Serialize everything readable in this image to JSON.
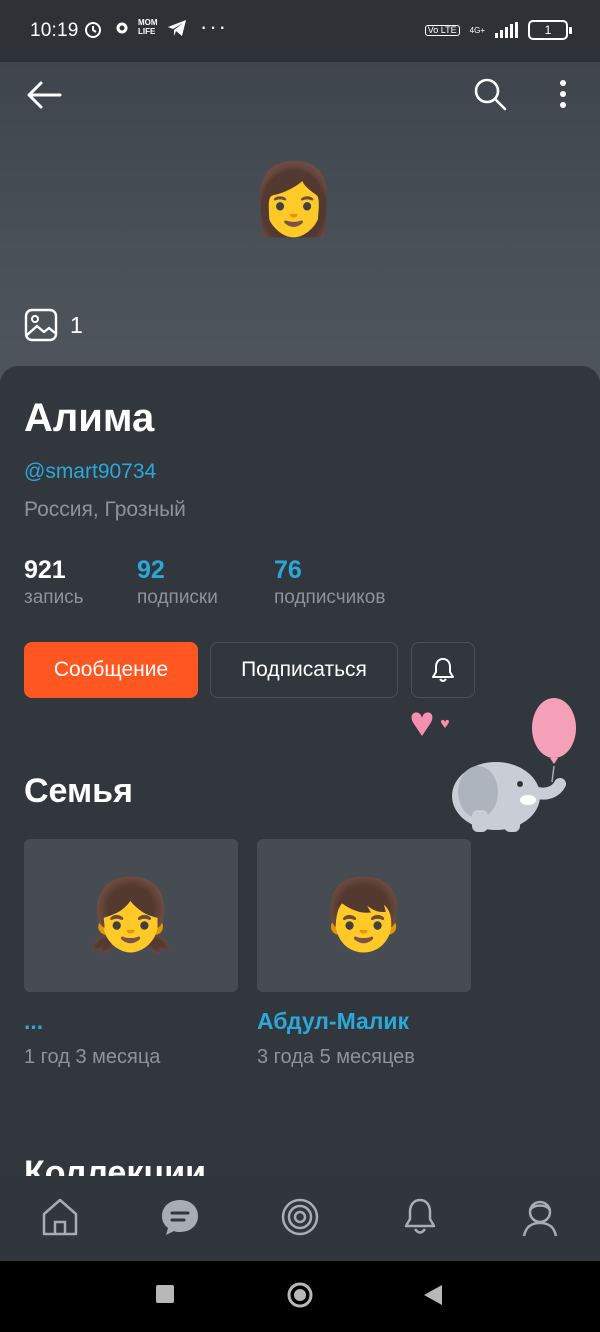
{
  "status_bar": {
    "time": "10:19",
    "more": "···",
    "volte": "Vo LTE",
    "network": "4G+",
    "battery": "1"
  },
  "header": {
    "photo_count": "1",
    "avatar_emoji": "👩"
  },
  "profile": {
    "name": "Алима",
    "handle": "@smart90734",
    "location": "Россия, Грозный",
    "stats": [
      {
        "value": "921",
        "label": "запись"
      },
      {
        "value": "92",
        "label": "подписки"
      },
      {
        "value": "76",
        "label": "подписчиков"
      }
    ],
    "message_button": "Сообщение",
    "subscribe_button": "Подписаться"
  },
  "family": {
    "title": "Семья",
    "members": [
      {
        "emoji": "👧",
        "name": "...",
        "age": "1 год 3 месяца"
      },
      {
        "emoji": "👦",
        "name": "Абдул-Малик",
        "age": "3 года 5 месяцев"
      }
    ]
  },
  "collections": {
    "title": "Коллекции"
  },
  "colors": {
    "accent": "#ff5722",
    "link": "#2aa8d8",
    "background": "#32373e"
  },
  "bottom_nav": [
    "home-icon",
    "chat-icon",
    "target-icon",
    "bell-icon",
    "profile-icon"
  ]
}
